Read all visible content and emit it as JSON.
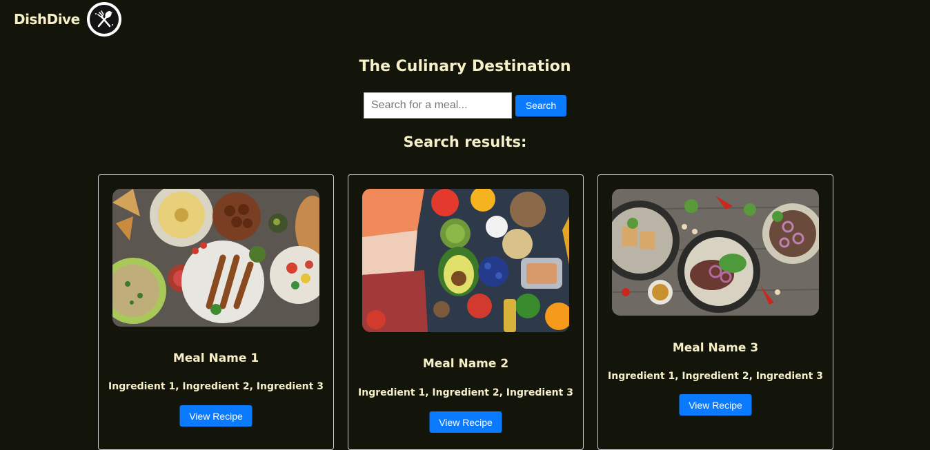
{
  "header": {
    "brand_name": "DishDive",
    "logo_icon": "fork-spoon-icon"
  },
  "hero": {
    "tagline": "The Culinary Destination"
  },
  "search": {
    "placeholder": "Search for a meal...",
    "value": "",
    "button_label": "Search"
  },
  "results": {
    "heading": "Search results:",
    "cards": [
      {
        "title": "Meal Name 1",
        "ingredients": "Ingredient 1, Ingredient 2, Ingredient 3",
        "button_label": "View Recipe",
        "image_icon": "mezze-platter-image"
      },
      {
        "title": "Meal Name 2",
        "ingredients": "Ingredient 1, Ingredient 2, Ingredient 3",
        "button_label": "View Recipe",
        "image_icon": "fresh-produce-image"
      },
      {
        "title": "Meal Name 3",
        "ingredients": "Ingredient 1, Ingredient 2, Ingredient 3",
        "button_label": "View Recipe",
        "image_icon": "steak-bowls-image"
      }
    ]
  },
  "colors": {
    "background": "#13140a",
    "text": "#f7efc8",
    "accent": "#0a7bff"
  }
}
